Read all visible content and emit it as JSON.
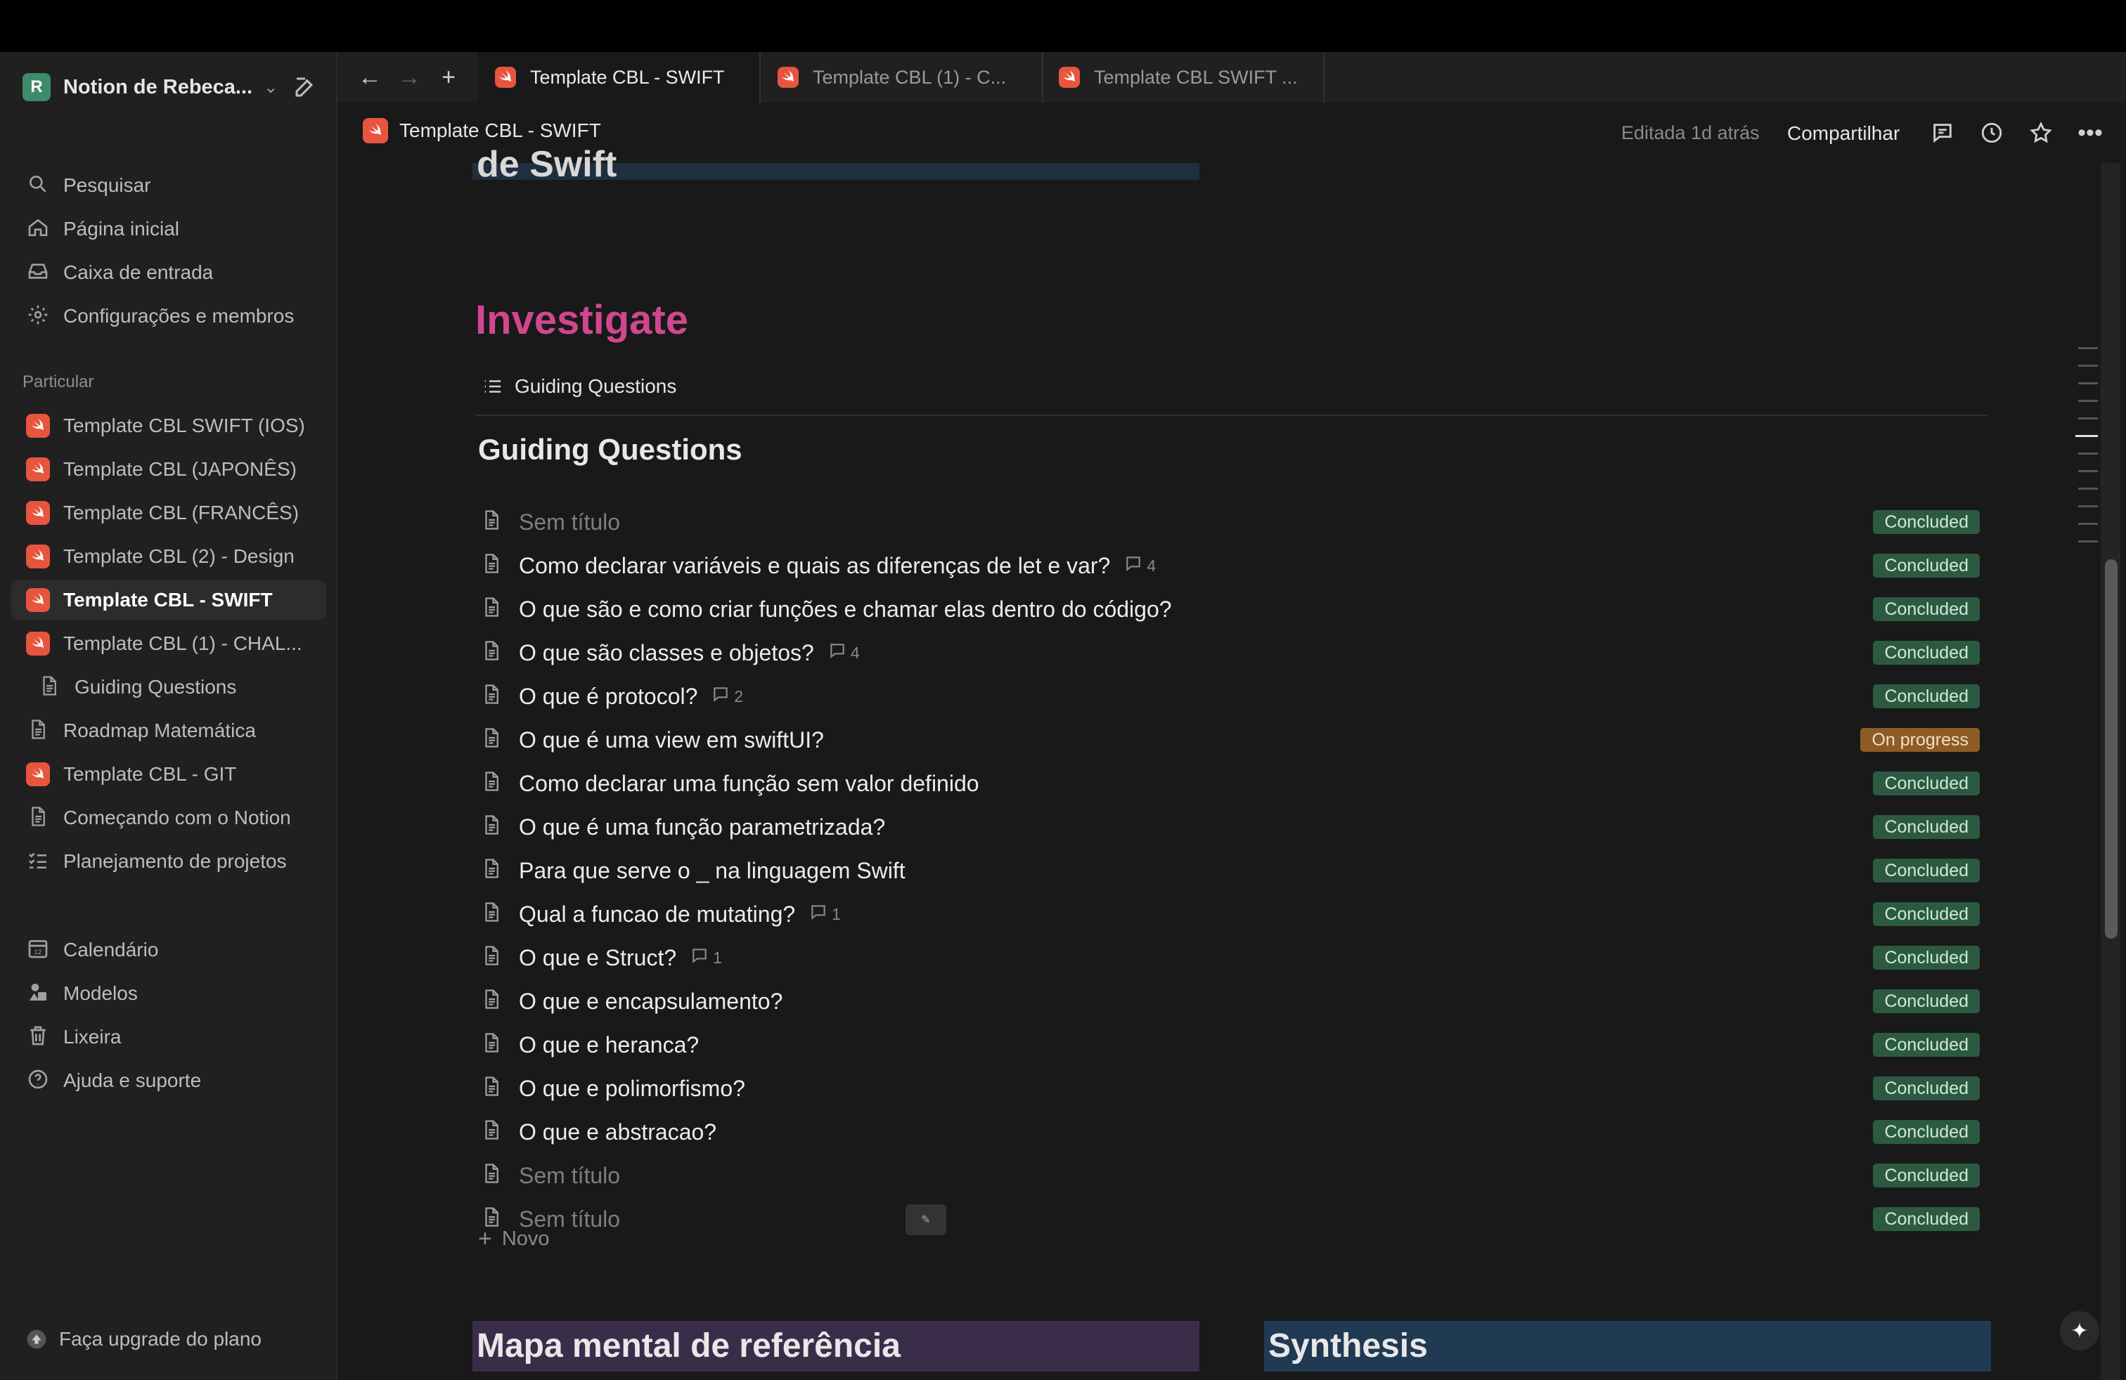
{
  "workspace": {
    "initial": "R",
    "name": "Notion de Rebeca..."
  },
  "sidebar": {
    "top": [
      {
        "label": "Pesquisar",
        "icon": "search-icon"
      },
      {
        "label": "Página inicial",
        "icon": "home-icon"
      },
      {
        "label": "Caixa de entrada",
        "icon": "inbox-icon"
      },
      {
        "label": "Configurações e membros",
        "icon": "gear-icon"
      }
    ],
    "section_label": "Particular",
    "pages": [
      {
        "label": "Template CBL SWIFT (IOS)",
        "icon": "swift-icon"
      },
      {
        "label": "Template CBL (JAPONÊS)",
        "icon": "swift-icon"
      },
      {
        "label": "Template CBL (FRANCÊS)",
        "icon": "swift-icon"
      },
      {
        "label": "Template CBL (2) - Design",
        "icon": "swift-icon"
      },
      {
        "label": "Template CBL - SWIFT",
        "icon": "swift-icon",
        "active": true
      },
      {
        "label": "Template CBL (1) - CHAL...",
        "icon": "swift-icon"
      },
      {
        "label": "Guiding Questions",
        "icon": "document-icon",
        "sub": true
      },
      {
        "label": "Roadmap Matemática",
        "icon": "document-icon"
      },
      {
        "label": "Template CBL - GIT",
        "icon": "swift-icon"
      },
      {
        "label": "Começando com o Notion",
        "icon": "document-icon"
      },
      {
        "label": "Planejamento de projetos",
        "icon": "checklist-icon"
      }
    ],
    "bottom": [
      {
        "label": "Calendário",
        "icon": "calendar-icon"
      },
      {
        "label": "Modelos",
        "icon": "templates-icon"
      },
      {
        "label": "Lixeira",
        "icon": "trash-icon"
      },
      {
        "label": "Ajuda e suporte",
        "icon": "help-icon"
      }
    ],
    "upgrade": "Faça upgrade do plano"
  },
  "tabs": [
    {
      "label": "Template CBL - SWIFT",
      "active": true
    },
    {
      "label": "Template CBL (1) - C..."
    },
    {
      "label": "Template CBL SWIFT ..."
    }
  ],
  "header": {
    "breadcrumb": "Template CBL - SWIFT",
    "edited": "Editada 1d atrás",
    "share": "Compartilhar"
  },
  "page": {
    "prev_heading": "de Swift",
    "section_title": "Investigate",
    "view_tab": "Guiding Questions",
    "db_title": "Guiding Questions",
    "rows": [
      {
        "title": "Sem título",
        "untitled": true,
        "comments": null,
        "status": "Concluded"
      },
      {
        "title": "Como declarar variáveis e quais as diferenças de let e var?",
        "comments": "4",
        "status": "Concluded"
      },
      {
        "title": "O que são e como criar funções e chamar elas dentro do código?",
        "comments": null,
        "status": "Concluded"
      },
      {
        "title": "O que são classes e objetos?",
        "comments": "4",
        "status": "Concluded"
      },
      {
        "title": "O que é protocol?",
        "comments": "2",
        "status": "Concluded"
      },
      {
        "title": "O que é uma view em swiftUI?",
        "comments": null,
        "status": "On progress"
      },
      {
        "title": "Como declarar uma função sem valor definido",
        "comments": null,
        "status": "Concluded"
      },
      {
        "title": "O que é uma função parametrizada?",
        "comments": null,
        "status": "Concluded"
      },
      {
        "title": "Para que serve o _ na linguagem Swift",
        "comments": null,
        "status": "Concluded"
      },
      {
        "title": "Qual a funcao de mutating?",
        "comments": "1",
        "status": "Concluded"
      },
      {
        "title": "O que e Struct?",
        "comments": "1",
        "status": "Concluded"
      },
      {
        "title": "O que e encapsulamento?",
        "comments": null,
        "status": "Concluded"
      },
      {
        "title": "O que e heranca?",
        "comments": null,
        "status": "Concluded"
      },
      {
        "title": "O que e polimorfismo?",
        "comments": null,
        "status": "Concluded"
      },
      {
        "title": "O que e abstracao?",
        "comments": null,
        "status": "Concluded"
      },
      {
        "title": "Sem título",
        "untitled": true,
        "comments": null,
        "status": "Concluded"
      },
      {
        "title": "Sem título",
        "untitled": true,
        "comments": null,
        "status": "Concluded",
        "edit_pill": true
      }
    ],
    "add_new": "Novo",
    "block_left": "Mapa mental de referência",
    "block_right": "Synthesis"
  },
  "colors": {
    "accent_pink": "#d1468f",
    "concluded_bg": "#2b5a41",
    "progress_bg": "#8d5b26",
    "swift": "#e8553f"
  }
}
